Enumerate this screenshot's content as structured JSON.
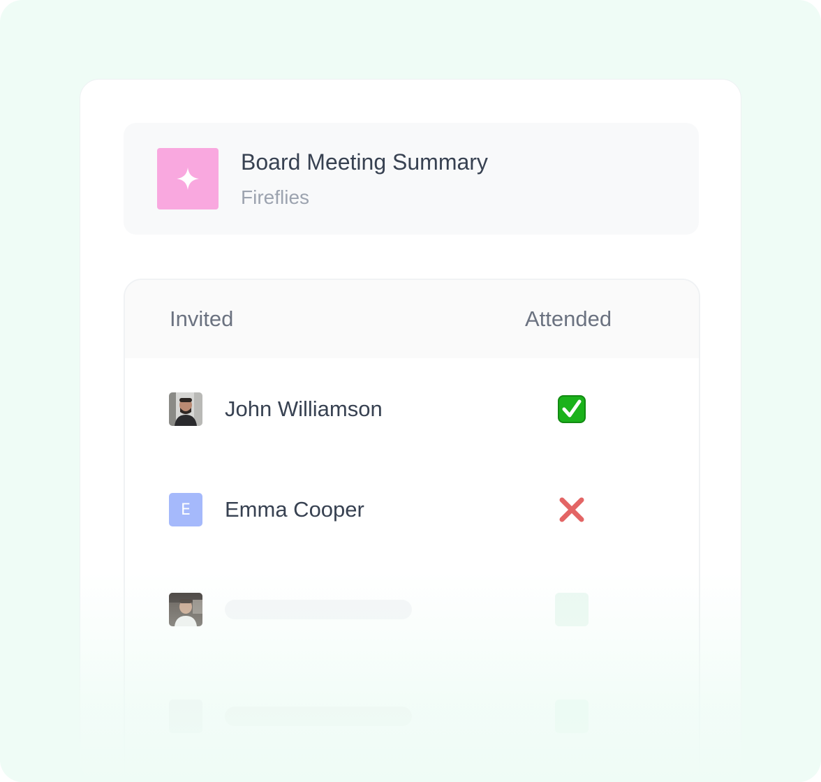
{
  "meeting": {
    "title": "Board Meeting Summary",
    "source": "Fireflies",
    "icon": "sparkle-icon",
    "icon_bg": "#f9a8df"
  },
  "table": {
    "col_invited": "Invited",
    "col_attended": "Attended"
  },
  "attendees": [
    {
      "name": "John Williamson",
      "avatar": "photo",
      "attended": true,
      "status_icon": "check-mark-icon"
    },
    {
      "name": "Emma Cooper",
      "avatar_letter": "E",
      "attended": false,
      "status_icon": "cross-mark-icon"
    }
  ],
  "colors": {
    "background": "#effcf6",
    "check_green": "#1bb21b",
    "cross_red": "#e36565",
    "letter_avatar": "#a5b9fb"
  }
}
